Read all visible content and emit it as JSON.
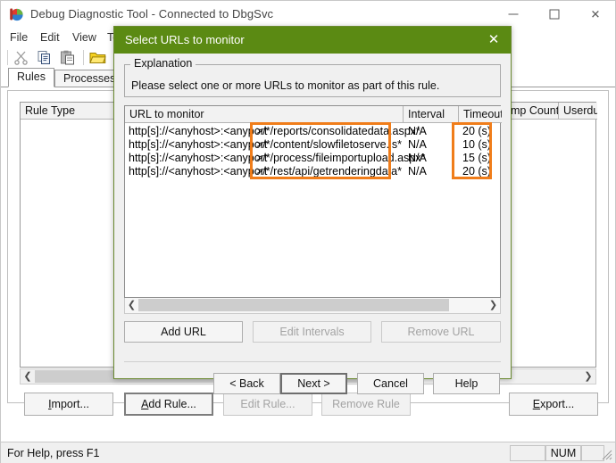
{
  "window": {
    "title": "Debug Diagnostic Tool - Connected to DbgSvc",
    "icon": "app-icon",
    "minimize_label": "—",
    "maximize_label": "□",
    "close_label": "✕"
  },
  "menu": {
    "items": [
      {
        "label": "File"
      },
      {
        "label": "Edit"
      },
      {
        "label": "View"
      },
      {
        "label": "To"
      }
    ]
  },
  "toolbar": {
    "items": [
      {
        "name": "cut-icon",
        "glyph": "✂"
      },
      {
        "name": "copy-icon",
        "glyph": "⧉"
      },
      {
        "name": "paste-icon",
        "glyph": "Ὄb"
      },
      {
        "name": "open-folder-icon",
        "glyph": "Ὄ1"
      },
      {
        "name": "help-icon",
        "glyph": "?"
      }
    ]
  },
  "tabs": [
    {
      "label": "Rules",
      "active": true
    },
    {
      "label": "Processes",
      "active": false
    }
  ],
  "main_list": {
    "columns": [
      {
        "label": "Rule Type"
      },
      {
        "label": "mp Count"
      },
      {
        "label": "Userdum"
      }
    ]
  },
  "main_buttons": [
    {
      "label": "Import...",
      "mnemonic": "I",
      "enabled": true,
      "default": false
    },
    {
      "label": "Add Rule...",
      "mnemonic": "A",
      "enabled": true,
      "default": true
    },
    {
      "label": "Edit Rule...",
      "mnemonic": "E",
      "enabled": false,
      "default": false
    },
    {
      "label": "Remove Rule",
      "mnemonic": "R",
      "enabled": false,
      "default": false
    },
    {
      "label": "Export...",
      "mnemonic": "E",
      "enabled": true,
      "default": false
    }
  ],
  "statusbar": {
    "help_text": "For Help, press F1",
    "num_indicator": "NUM"
  },
  "dialog": {
    "title": "Select URLs to monitor",
    "close_label": "✕",
    "explanation": {
      "legend": "Explanation",
      "text": "Please select one or more URLs to monitor as part of this rule."
    },
    "list": {
      "columns": [
        {
          "label": "URL to monitor"
        },
        {
          "label": "Interval"
        },
        {
          "label": "Timeout"
        }
      ],
      "rows": [
        {
          "prefix": "http[s]://<anyhost>:<anyport",
          "path": ">/*/reports/consolidatedata.aspx*",
          "interval": "N/A",
          "timeout": "20 (s)"
        },
        {
          "prefix": "http[s]://<anyhost>:<anyport",
          "path": ">/*/content/slowfiletoserve.js*",
          "interval": "N/A",
          "timeout": "10 (s)"
        },
        {
          "prefix": "http[s]://<anyhost>:<anyport",
          "path": ">/*/process/fileimportupload.aspx*",
          "interval": "N/A",
          "timeout": "15 (s)"
        },
        {
          "prefix": "http[s]://<anyhost>:<anyport",
          "path": ">/*/rest/api/getrenderingdata*",
          "interval": "N/A",
          "timeout": "20 (s)"
        }
      ]
    },
    "action_buttons": [
      {
        "label": "Add URL",
        "enabled": true
      },
      {
        "label": "Edit Intervals",
        "enabled": false
      },
      {
        "label": "Remove URL",
        "enabled": false
      }
    ],
    "nav_buttons": [
      {
        "label": "< Back",
        "enabled": true,
        "focused": false
      },
      {
        "label": "Next >",
        "enabled": true,
        "focused": true
      },
      {
        "label": "Cancel",
        "enabled": true,
        "focused": false
      },
      {
        "label": "Help",
        "enabled": true,
        "focused": false
      }
    ]
  },
  "annotations": {
    "color": "#f07d1a",
    "boxes": [
      {
        "name": "url-path-highlight"
      },
      {
        "name": "timeout-highlight"
      }
    ]
  }
}
